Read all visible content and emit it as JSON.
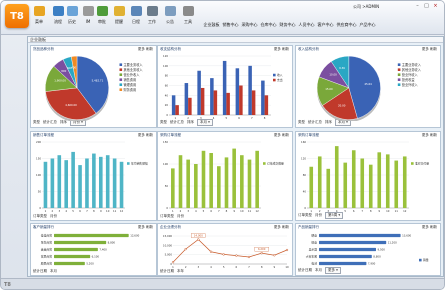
{
  "toolbar": {
    "logo": "T8",
    "buttons": [
      {
        "label": "菜单",
        "icon": "folder-icon",
        "color": "#e7a524"
      },
      {
        "label": "流程",
        "icon": "flow-icon",
        "color": "#3c7fc4"
      },
      {
        "label": "历史",
        "icon": "history-icon",
        "color": "#6aa3d8"
      },
      {
        "label": "IM",
        "icon": "chat-icon",
        "color": "#9a9a9a"
      },
      {
        "label": "审批",
        "icon": "approve-icon",
        "color": "#4f9c3b"
      },
      {
        "label": "提醒",
        "icon": "reminder-icon",
        "color": "#e0b133"
      },
      {
        "label": "日程",
        "icon": "calendar-icon",
        "color": "#5b86b8"
      },
      {
        "label": "工作",
        "icon": "work-icon",
        "color": "#6c7c8c"
      },
      {
        "label": "公告",
        "icon": "notice-icon",
        "color": "#7d9dbf"
      },
      {
        "label": "工具",
        "icon": "tools-icon",
        "color": "#8a8a8a"
      }
    ],
    "modules": [
      "企业鼓板",
      "销售中心",
      "采购中心",
      "仓库中心",
      "财务中心",
      "人员中心",
      "客户中心",
      "供应商中心",
      "产品中心"
    ],
    "user": "公司 >ADMIN"
  },
  "tab": {
    "title": "企业鼓板"
  },
  "status": {
    "logo": "T8"
  },
  "panels": [
    {
      "title": "货品品种分析",
      "more": "更多",
      "refresh": "刷新",
      "footer": [
        "类型",
        "统计汇总",
        "排序"
      ],
      "foot_dd": "月份"
    },
    {
      "title": "收支结构分析",
      "more": "更多",
      "refresh": "刷新",
      "footer": [
        "类型",
        "统计汇总",
        "排序"
      ],
      "foot_dd": "本月"
    },
    {
      "title": "收入结构分析",
      "more": "更多",
      "refresh": "刷新",
      "footer": [
        "类型",
        "统计汇总",
        "排序"
      ],
      "foot_dd": "本月"
    },
    {
      "title": "销售订单流程",
      "more": "更多",
      "refresh": "刷新",
      "footer": [
        "订单类型",
        "月份"
      ],
      "foot_dd": ""
    },
    {
      "title": "采购订单流程",
      "more": "更多",
      "refresh": "刷新",
      "footer": [
        "订单类型",
        "月份"
      ],
      "foot_dd": ""
    },
    {
      "title": "采购订单流程",
      "more": "更多",
      "refresh": "刷新",
      "footer": [
        "订单类型",
        "月份"
      ],
      "foot_dd": "第5周"
    },
    {
      "title": "客户销量排行",
      "more": "更多",
      "refresh": "刷新",
      "footer": [
        "统计日期",
        "本月"
      ],
      "foot_dd": ""
    },
    {
      "title": "企业业绩分析",
      "more": "更多",
      "refresh": "刷新",
      "footer": [
        "统计日期",
        "本年"
      ],
      "foot_dd": ""
    },
    {
      "title": "产品销量排行",
      "more": "更多",
      "refresh": "刷新",
      "footer": [
        "统计日期",
        "本月"
      ],
      "foot_dd": "更多"
    }
  ],
  "chart_data": [
    {
      "type": "pie",
      "panel": 0,
      "values": [
        5482.71,
        4600,
        1900,
        800,
        600,
        400
      ],
      "labels": [
        "5,482.71",
        "4,600.00",
        "1,900.00",
        "800",
        "600",
        "400"
      ],
      "legend": [
        "主要业务收入",
        "其他业务收入",
        "营业外收入",
        "销售费用",
        "管理费用",
        "财务费用"
      ],
      "colors": [
        "#3a63b5",
        "#c0392b",
        "#7aa83a",
        "#7b4fa0",
        "#2aa7c4",
        "#f08a24"
      ]
    },
    {
      "type": "bar",
      "panel": 1,
      "categories": [
        "1",
        "2",
        "3",
        "4",
        "5",
        "6",
        "7",
        "8"
      ],
      "series": [
        {
          "name": "收入",
          "values": [
            40,
            65,
            90,
            75,
            110,
            95,
            100,
            70
          ],
          "color": "#3a63b5"
        },
        {
          "name": "支出",
          "values": [
            20,
            35,
            55,
            50,
            45,
            60,
            50,
            40
          ],
          "color": "#c0392b"
        }
      ],
      "ylim": [
        0,
        120
      ],
      "yticks": [
        "0",
        "20",
        "40",
        "60",
        "80",
        "100",
        "120"
      ]
    },
    {
      "type": "pie",
      "panel": 2,
      "values": [
        45.64,
        20,
        15,
        10,
        9.36
      ],
      "labels": [
        "45.64",
        "20.00",
        "15.00",
        "10.00",
        "9.36"
      ],
      "legend": [
        "主要业务收入",
        "其他业务收入",
        "营业外收入",
        "投资收益",
        "营业外收入"
      ],
      "colors": [
        "#3a63b5",
        "#c0392b",
        "#7aa83a",
        "#7b4fa0",
        "#2aa7c4"
      ]
    },
    {
      "type": "bar",
      "panel": 3,
      "categories": [
        "1",
        "2",
        "3",
        "4",
        "5",
        "6",
        "7",
        "8",
        "9",
        "10",
        "11",
        "12"
      ],
      "series": [
        {
          "name": "年均销售额幅",
          "values": [
            140,
            150,
            160,
            145,
            170,
            130,
            150,
            165,
            155,
            160,
            150,
            140
          ],
          "color": "#4fb5c6"
        }
      ],
      "ylim": [
        0,
        200
      ],
      "yticks": [
        "0",
        "50",
        "100",
        "150",
        "200"
      ]
    },
    {
      "type": "bar",
      "panel": 4,
      "categories": [
        "1",
        "2",
        "3",
        "4",
        "5",
        "6",
        "7",
        "8",
        "9",
        "10",
        "11",
        "12"
      ],
      "series": [
        {
          "name": "订单成交数量",
          "values": [
            90,
            120,
            110,
            100,
            130,
            125,
            95,
            115,
            135,
            120,
            110,
            130
          ],
          "color": "#9ac13b"
        }
      ],
      "ylim": [
        0,
        150
      ],
      "yticks": [
        "0",
        "50",
        "100",
        "150"
      ]
    },
    {
      "type": "bar",
      "panel": 5,
      "categories": [
        "1",
        "2",
        "3",
        "4",
        "5",
        "6",
        "7",
        "8",
        "9",
        "10",
        "11",
        "12"
      ],
      "series": [
        {
          "name": "准时交付量",
          "values": [
            100,
            125,
            95,
            150,
            110,
            140,
            120,
            105,
            135,
            130,
            115,
            125
          ],
          "color": "#9ac13b"
        }
      ],
      "ylim": [
        0,
        160
      ],
      "yticks": [
        "0",
        "40",
        "80",
        "120",
        "160"
      ]
    },
    {
      "type": "hbar",
      "panel": 6,
      "categories": [
        "佳佳商贸",
        "张生商贸",
        "美美商贸",
        "富民商贸",
        "顺民商贸"
      ],
      "values": [
        12600,
        8800,
        7400,
        6100,
        5200
      ],
      "labels": [
        "12,600",
        "8,800",
        "7,400",
        "6,100",
        "5,200"
      ],
      "color": "#7fb03a",
      "xlim": [
        0,
        14000
      ]
    },
    {
      "type": "line",
      "panel": 7,
      "categories": [
        "1",
        "2",
        "3",
        "4",
        "5",
        "6",
        "7",
        "8",
        "9",
        "10"
      ],
      "values": [
        1000,
        8500,
        14000,
        7000,
        5500,
        4800,
        4000,
        6200,
        5000,
        8000
      ],
      "labels": [
        "",
        "",
        "14,000",
        "",
        "",
        "",
        "",
        "6,200",
        "",
        ""
      ],
      "color": "#c85a2a",
      "ylim": [
        0,
        16000
      ],
      "yticks": [
        "0",
        "5,000",
        "10,000",
        "15,000"
      ]
    },
    {
      "type": "hbar",
      "panel": 8,
      "categories": [
        "硬盘",
        "键盘",
        "显示器",
        "大客车厢",
        "电池"
      ],
      "values": [
        13600,
        11200,
        9500,
        8800,
        7900
      ],
      "labels": [
        "13,600",
        "11,200",
        "9,500",
        "8,800",
        "7,900"
      ],
      "color": "#3f6fb8",
      "xlim": [
        0,
        16000
      ],
      "legend": "销量"
    }
  ]
}
